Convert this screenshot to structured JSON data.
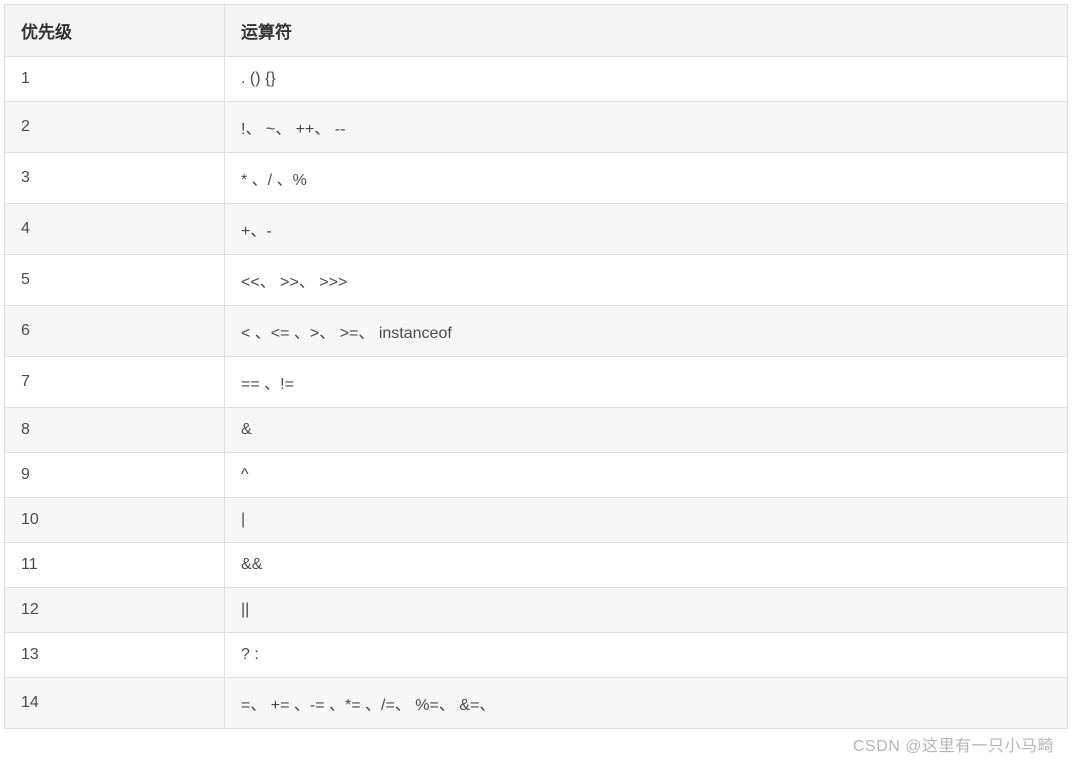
{
  "table": {
    "headers": {
      "priority": "优先级",
      "operator": "运算符"
    },
    "rows": [
      {
        "priority": "1",
        "operator": ". () {}"
      },
      {
        "priority": "2",
        "operator": "!、 ~、  ++、 --"
      },
      {
        "priority": "3",
        "operator": "* 、/ 、%"
      },
      {
        "priority": "4",
        "operator": "+、-"
      },
      {
        "priority": "5",
        "operator": "<<、  >>、  >>>"
      },
      {
        "priority": "6",
        "operator": "< 、<= 、>、 >=、  instanceof"
      },
      {
        "priority": "7",
        "operator": "== 、!="
      },
      {
        "priority": "8",
        "operator": "&"
      },
      {
        "priority": "9",
        "operator": "^"
      },
      {
        "priority": "10",
        "operator": "|"
      },
      {
        "priority": "11",
        "operator": "&&"
      },
      {
        "priority": "12",
        "operator": "||"
      },
      {
        "priority": "13",
        "operator": "? :"
      },
      {
        "priority": "14",
        "operator": "=、  += 、-= 、*= 、/=、  %=、 &=、"
      }
    ]
  },
  "watermark": "CSDN @这里有一只小马畸"
}
